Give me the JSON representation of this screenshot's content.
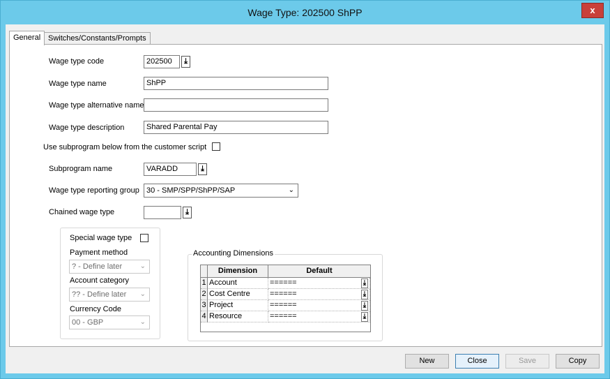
{
  "window": {
    "title": "Wage Type: 202500 ShPP",
    "close_glyph": "x"
  },
  "tabs": [
    {
      "label": "General",
      "active": true
    },
    {
      "label": "Switches/Constants/Prompts",
      "active": false
    }
  ],
  "form": {
    "wage_type_code": {
      "label": "Wage type code",
      "value": "202500"
    },
    "wage_type_name": {
      "label": "Wage type name",
      "value": "ShPP"
    },
    "wage_type_alt_name": {
      "label": "Wage type alternative name",
      "value": ""
    },
    "wage_type_description": {
      "label": "Wage type description",
      "value": "Shared Parental Pay"
    },
    "use_subprogram": {
      "label": "Use subprogram below from the customer script",
      "checked": false
    },
    "subprogram_name": {
      "label": "Subprogram name",
      "value": "VARADD"
    },
    "reporting_group": {
      "label": "Wage type reporting group",
      "value": "30 - SMP/SPP/ShPP/SAP"
    },
    "chained_wage_type": {
      "label": "Chained wage type",
      "value": ""
    },
    "lookup_glyph": "⤓",
    "combo_arrow": "⌄"
  },
  "special": {
    "special_wage_type": {
      "label": "Special wage type",
      "checked": false
    },
    "payment_method": {
      "label": "Payment method",
      "value": "? - Define later"
    },
    "account_category": {
      "label": "Account category",
      "value": "?? - Define later"
    },
    "currency_code": {
      "label": "Currency Code",
      "value": "00 - GBP"
    }
  },
  "accounting": {
    "title": "Accounting Dimensions",
    "headers": {
      "dimension": "Dimension",
      "default": "Default"
    },
    "rows": [
      {
        "num": "1",
        "dimension": "Account",
        "default": "======"
      },
      {
        "num": "2",
        "dimension": "Cost Centre",
        "default": "======"
      },
      {
        "num": "3",
        "dimension": "Project",
        "default": "======"
      },
      {
        "num": "4",
        "dimension": "Resource",
        "default": "======"
      }
    ]
  },
  "buttons": {
    "new": {
      "label": "New",
      "enabled": true
    },
    "close": {
      "label": "Close",
      "enabled": true
    },
    "save": {
      "label": "Save",
      "enabled": false
    },
    "copy": {
      "label": "Copy",
      "enabled": true
    }
  },
  "colors": {
    "titlebar": "#6ccaea",
    "close_button": "#c9403a",
    "client": "#f0f0f0"
  }
}
